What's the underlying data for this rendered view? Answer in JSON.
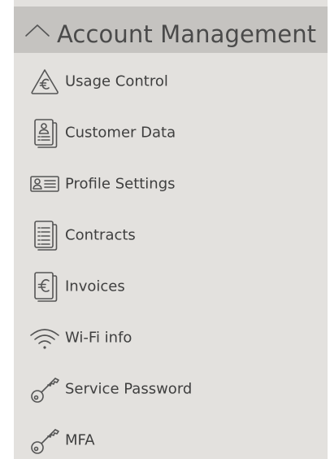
{
  "header": {
    "title": "Account Management",
    "icon": "chevron-up-icon"
  },
  "menu": {
    "items": [
      {
        "label": "Usage Control",
        "icon": "euro-triangle-icon"
      },
      {
        "label": "Customer Data",
        "icon": "person-document-icon"
      },
      {
        "label": "Profile Settings",
        "icon": "id-card-icon"
      },
      {
        "label": "Contracts",
        "icon": "documents-icon"
      },
      {
        "label": "Invoices",
        "icon": "euro-documents-icon"
      },
      {
        "label": "Wi-Fi info",
        "icon": "wifi-icon"
      },
      {
        "label": "Service Password",
        "icon": "key-icon"
      },
      {
        "label": "MFA",
        "icon": "key-icon"
      }
    ]
  },
  "colors": {
    "panel_bg": "#e3e1de",
    "header_bg": "#c5c3c0",
    "text": "#3f3f3f",
    "title_text": "#4a4a4a"
  }
}
